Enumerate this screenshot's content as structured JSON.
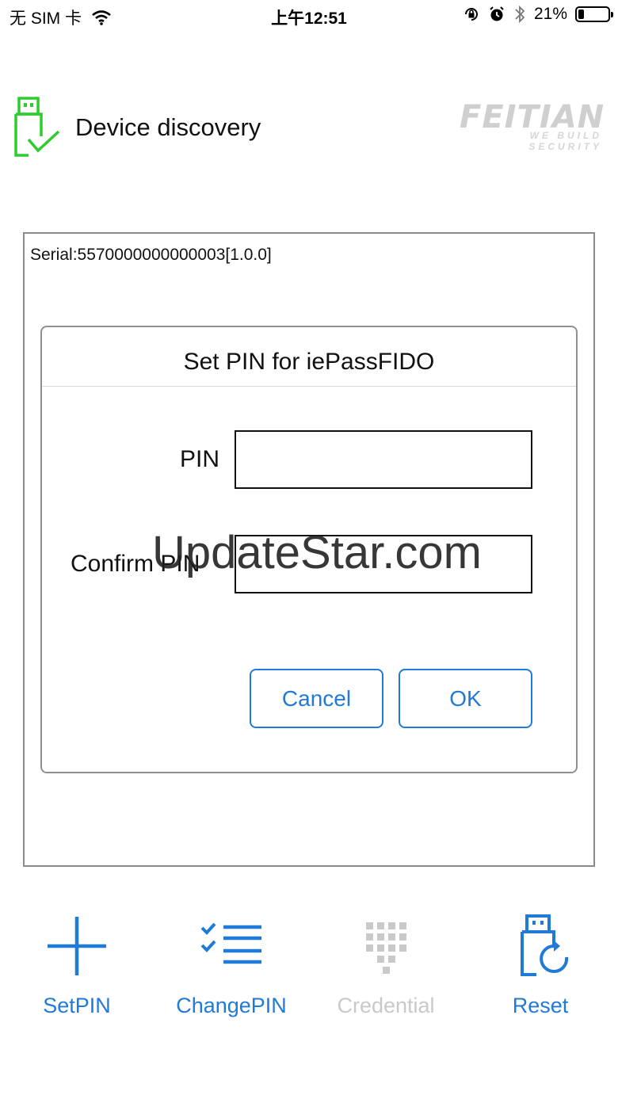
{
  "status_bar": {
    "carrier": "无 SIM 卡",
    "time": "上午12:51",
    "battery_percent": "21%",
    "icons": [
      "wifi-icon",
      "orientation-lock-icon",
      "alarm-icon",
      "bluetooth-icon",
      "battery-icon"
    ]
  },
  "header": {
    "title": "Device discovery",
    "icon": "usb-key-check-icon",
    "brand_name": "FEITIAN",
    "brand_tagline": "WE BUILD SECURITY"
  },
  "device": {
    "serial": "Serial:5570000000000003[1.0.0]"
  },
  "dialog": {
    "title": "Set PIN for iePassFIDO",
    "pin_label": "PIN",
    "pin_value": "",
    "confirm_label": "Confirm PIN",
    "confirm_value": "",
    "cancel_label": "Cancel",
    "ok_label": "OK"
  },
  "watermark": "UpdateStar.com",
  "tabs": [
    {
      "label": "SetPIN",
      "icon": "plus-icon",
      "enabled": true
    },
    {
      "label": "ChangePIN",
      "icon": "checklist-icon",
      "enabled": true
    },
    {
      "label": "Credential",
      "icon": "keypad-icon",
      "enabled": false
    },
    {
      "label": "Reset",
      "icon": "usb-reset-icon",
      "enabled": true
    }
  ],
  "colors": {
    "accent": "#1f7ad8",
    "device_icon": "#2ecc2e",
    "disabled": "#c9c9c9"
  }
}
